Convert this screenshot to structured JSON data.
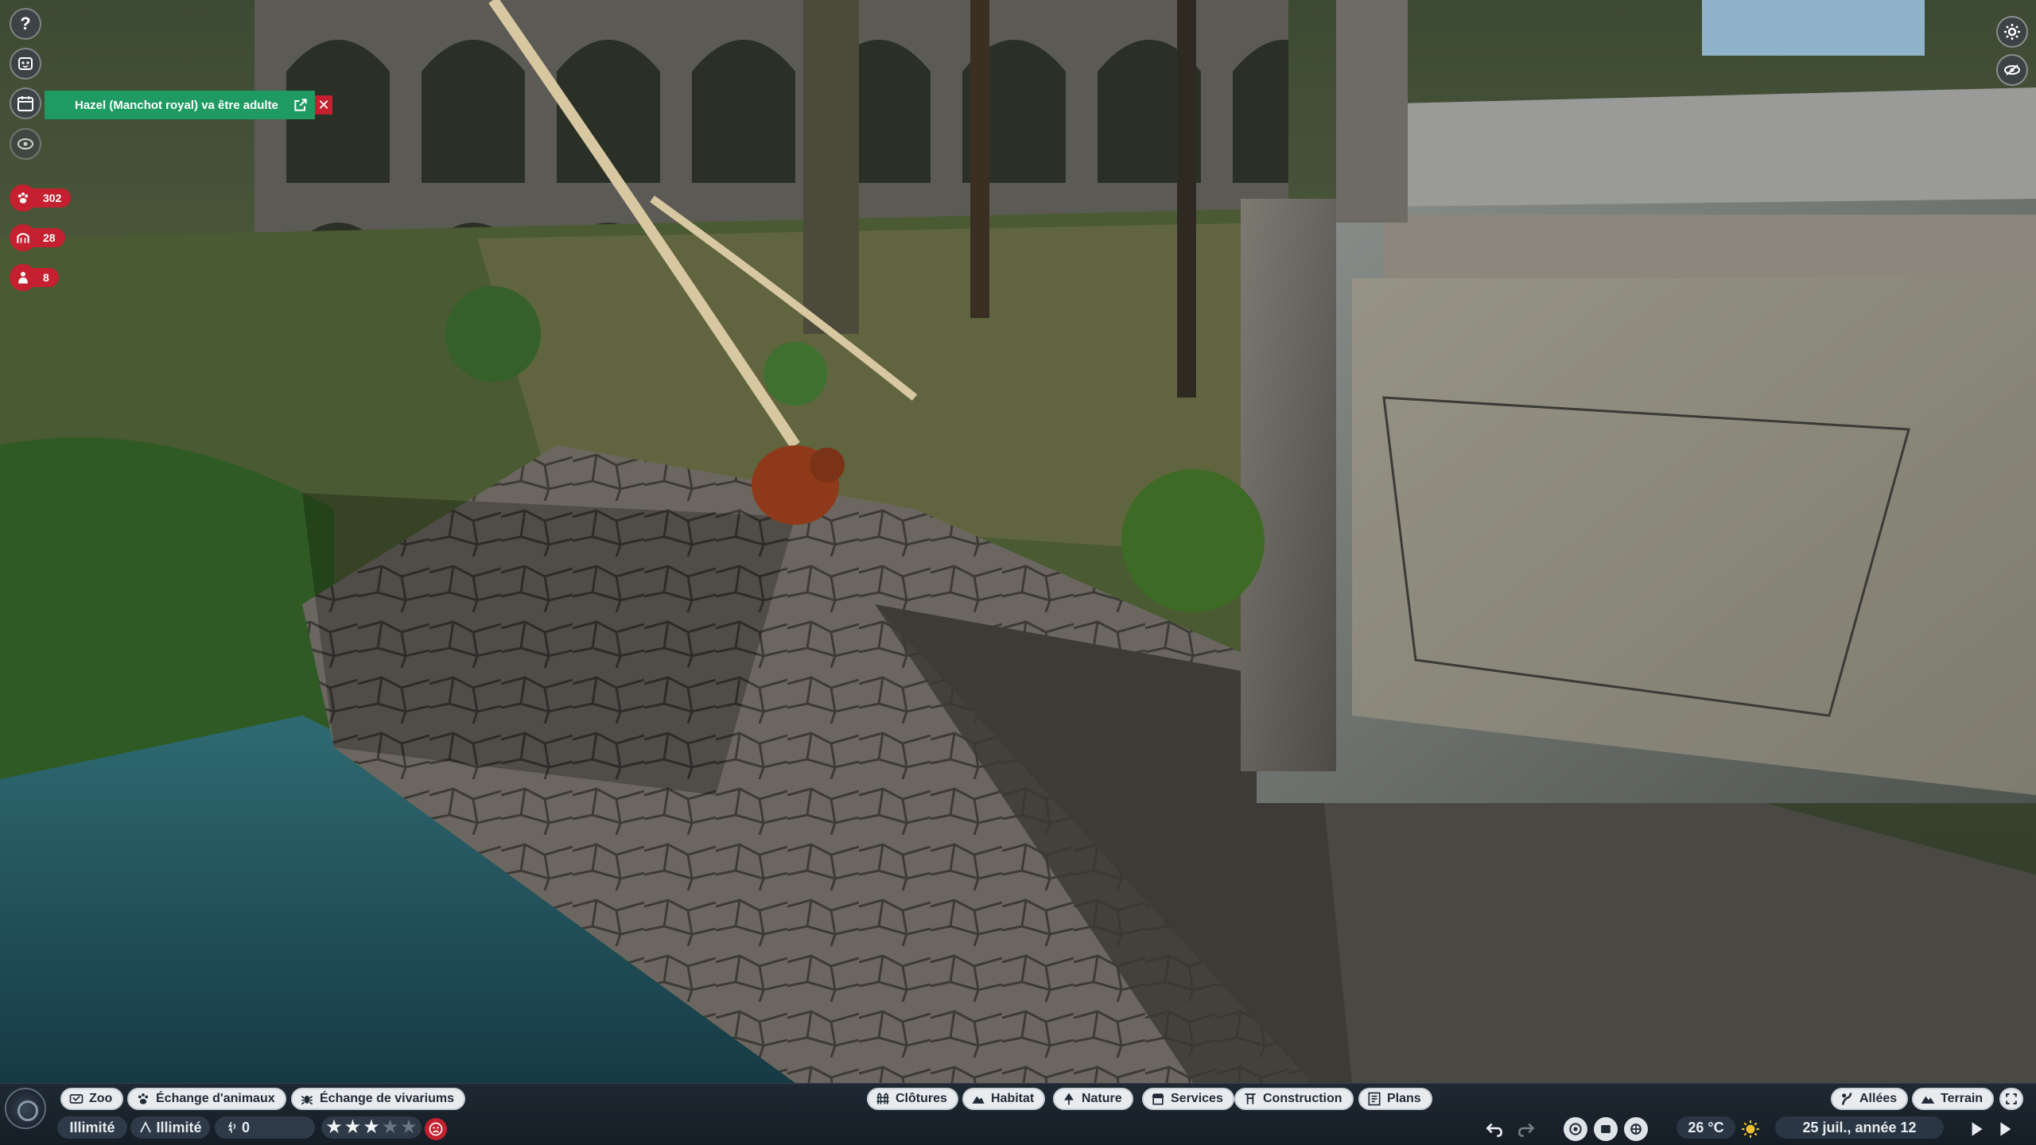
{
  "notification": {
    "message": "Hazel (Manchot royal) va être adulte"
  },
  "left_stats": {
    "animals": "302",
    "guests": "28",
    "staff": "8"
  },
  "toolbar": {
    "left_tabs": [
      {
        "label": "Zoo",
        "icon": "zoo-icon"
      },
      {
        "label": "Échange d'animaux",
        "icon": "paw-icon"
      },
      {
        "label": "Échange de vivariums",
        "icon": "bug-icon"
      }
    ],
    "center_tabs": [
      {
        "label": "Clôtures",
        "icon": "fence-icon"
      },
      {
        "label": "Habitat",
        "icon": "habitat-icon"
      },
      {
        "label": "Nature",
        "icon": "tree-icon"
      },
      {
        "label": "Services",
        "icon": "shop-icon"
      },
      {
        "label": "Construction",
        "icon": "construction-icon"
      },
      {
        "label": "Plans",
        "icon": "blueprint-icon"
      }
    ],
    "right_tabs": [
      {
        "label": "Allées",
        "icon": "path-icon"
      },
      {
        "label": "Terrain",
        "icon": "terrain-icon"
      }
    ]
  },
  "status": {
    "money": "Illimité",
    "research": "Illimité",
    "conservation": "0",
    "rating_stars": 3,
    "rating_max": 5,
    "temperature": "26 °C",
    "date": "25 juil., année 12"
  },
  "colors": {
    "accent_red": "#c4202f",
    "notification_green": "#1e9a62",
    "bar_bg": "#1e2834"
  }
}
